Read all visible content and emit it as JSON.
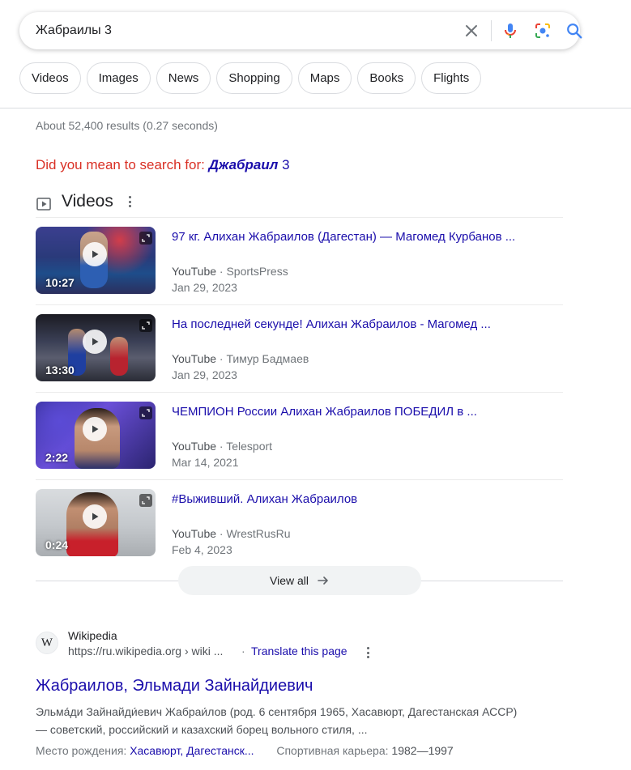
{
  "search": {
    "query": "Жабраилы 3",
    "clear_icon": "close-icon",
    "mic_icon": "mic-icon",
    "lens_icon": "lens-icon",
    "search_icon": "search-icon"
  },
  "chips": [
    "Videos",
    "Images",
    "News",
    "Shopping",
    "Maps",
    "Books",
    "Flights"
  ],
  "result_stats": "About 52,400 results (0.27 seconds)",
  "did_you_mean": {
    "prefix": "Did you mean to search for:",
    "suggestion_bold": "Джабраил",
    "suggestion_rest": "3"
  },
  "videos": {
    "heading": "Videos",
    "items": [
      {
        "title": "97 кг. Алихан Жабраилов (Дагестан) — Магомед Курбанов ...",
        "platform": "YouTube",
        "channel": "SportsPress",
        "date": "Jan 29, 2023",
        "duration": "10:27"
      },
      {
        "title": "На последней секунде! Алихан Жабраилов - Магомед ...",
        "platform": "YouTube",
        "channel": "Тимур Бадмаев",
        "date": "Jan 29, 2023",
        "duration": "13:30"
      },
      {
        "title": "ЧЕМПИОН России Алихан Жабраилов ПОБЕДИЛ в ...",
        "platform": "YouTube",
        "channel": "Telesport",
        "date": "Mar 14, 2021",
        "duration": "2:22"
      },
      {
        "title": "#Выживший. Алихан Жабраилов",
        "platform": "YouTube",
        "channel": "WrestRusRu",
        "date": "Feb 4, 2023",
        "duration": "0:24"
      }
    ],
    "view_all": "View all"
  },
  "wiki_result": {
    "favicon_letter": "W",
    "site_name": "Wikipedia",
    "url": "https://ru.wikipedia.org › wiki ...",
    "separator": "·",
    "translate": "Translate this page",
    "title": "Жабраилов, Эльмади Зайнайдиевич",
    "snippet": "Эльма́ди Зайнайди́евич Жабраи́лов (род. 6 сентября 1965, Хасавюрт, Дагестанская АССР) — советский, российский и казахский борец вольного стиля, ...",
    "fact1_label": "Место рождения:",
    "fact1_value": "Хасавюрт, Дагестанск...",
    "fact2_label": "Спортивная карьера:",
    "fact2_value": "1982—1997"
  },
  "colors": {
    "link": "#1a0dab",
    "suggestion_red": "#d93025",
    "muted": "#70757a"
  }
}
